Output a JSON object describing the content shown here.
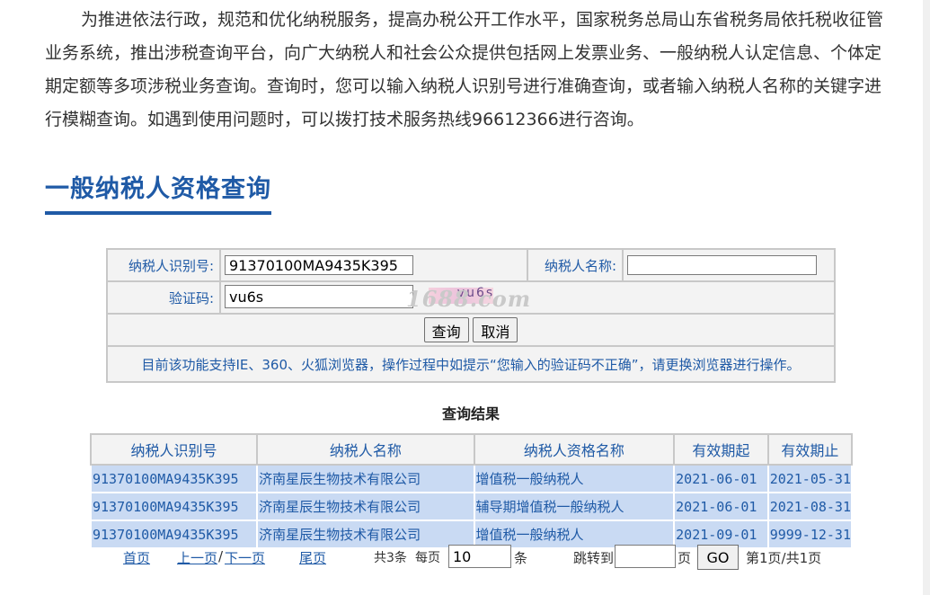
{
  "intro": "为推进依法行政，规范和优化纳税服务，提高办税公开工作水平，国家税务总局山东省税务局依托税收征管业务系统，推出涉税查询平台，向广大纳税人和社会公众提供包括网上发票业务、一般纳税人认定信息、个体定期定额等多项涉税业务查询。查询时，您可以输入纳税人识别号进行准确查询，或者输入纳税人名称的关键字进行模糊查询。如遇到使用问题时，可以拨打技术服务热线96612366进行咨询。",
  "section_title": "一般纳税人资格查询",
  "form": {
    "taxpayer_id_label": "纳税人识别号:",
    "taxpayer_id_value": "91370100MA9435K395",
    "taxpayer_name_label": "纳税人名称:",
    "taxpayer_name_value": "",
    "captcha_label": "验证码:",
    "captcha_value": "vu6s",
    "captcha_image_text": "vu6s",
    "query_button": "查询",
    "cancel_button": "取消",
    "notice": "目前该功能支持IE、360、火狐浏览器，操作过程中如提示“您输入的验证码不正确”，请更换浏览器进行操作。"
  },
  "watermark": "1688.com",
  "results": {
    "title": "查询结果",
    "headers": [
      "纳税人识别号",
      "纳税人名称",
      "纳税人资格名称",
      "有效期起",
      "有效期止"
    ],
    "rows": [
      [
        "91370100MA9435K395",
        "济南星辰生物技术有限公司",
        "增值税一般纳税人",
        "2021-06-01",
        "2021-05-31"
      ],
      [
        "91370100MA9435K395",
        "济南星辰生物技术有限公司",
        "辅导期增值税一般纳税人",
        "2021-06-01",
        "2021-08-31"
      ],
      [
        "91370100MA9435K395",
        "济南星辰生物技术有限公司",
        "增值税一般纳税人",
        "2021-09-01",
        "9999-12-31"
      ]
    ]
  },
  "pager": {
    "first": "首页",
    "prev": "上一页",
    "sep": "/",
    "next": "下一页",
    "last": "尾页",
    "total": "共3条",
    "per_page_label": "每页",
    "per_page_value": "10",
    "per_page_unit": "条",
    "jump_label": "跳转到",
    "jump_value": "",
    "jump_unit": "页",
    "go": "GO",
    "page_info": "第1页/共1页"
  }
}
